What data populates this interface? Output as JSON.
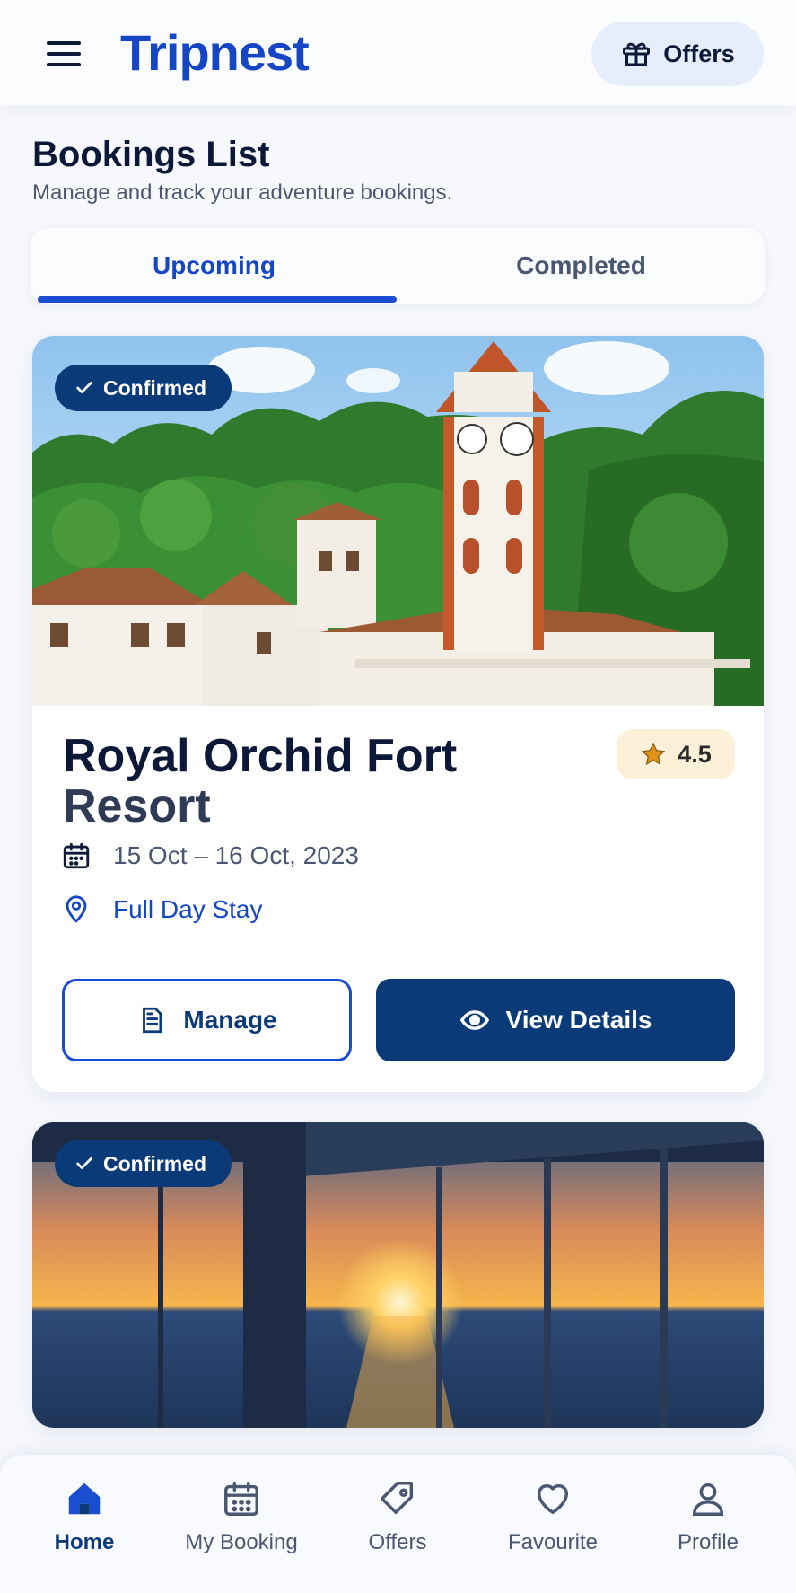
{
  "header": {
    "brand": "Tripnest",
    "offers_label": "Offers"
  },
  "page": {
    "title": "Bookings List",
    "subtitle": "Manage and track your adventure bookings."
  },
  "tabs": [
    {
      "label": "Upcoming",
      "active": true
    },
    {
      "label": "Completed",
      "active": false
    }
  ],
  "bookings": [
    {
      "status": "Confirmed",
      "title_line1": "Royal Orchid Fort",
      "title_line2": "Resort",
      "rating": "4.5",
      "dates": "15 Oct – 16 Oct, 2023",
      "stay_type": "Full Day Stay",
      "manage_label": "Manage",
      "view_label": "View Details"
    },
    {
      "status": "Confirmed"
    }
  ],
  "nav": [
    {
      "label": "Home",
      "icon": "home-icon",
      "active": true
    },
    {
      "label": "My Booking",
      "icon": "calendar-icon",
      "active": false
    },
    {
      "label": "Offers",
      "icon": "tag-icon",
      "active": false
    },
    {
      "label": "Favourite",
      "icon": "heart-icon",
      "active": false
    },
    {
      "label": "Profile",
      "icon": "user-icon",
      "active": false
    }
  ],
  "colors": {
    "brand": "#1546c6",
    "primary_dark": "#0b3a78",
    "rating_bg": "#fdf0d8",
    "star": "#e0921a"
  }
}
